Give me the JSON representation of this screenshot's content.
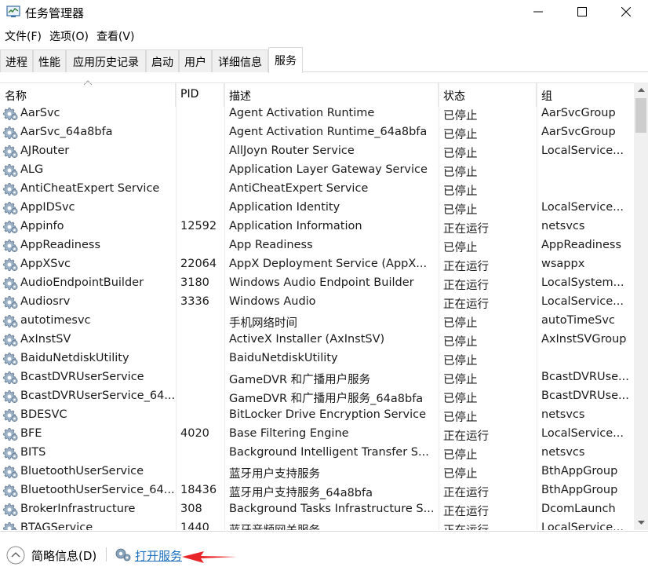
{
  "window": {
    "title": "任务管理器",
    "minimize_glyph": "—",
    "close_glyph": "✕"
  },
  "menu": [
    "文件(F)",
    "选项(O)",
    "查看(V)"
  ],
  "tabs": [
    "进程",
    "性能",
    "应用历史记录",
    "启动",
    "用户",
    "详细信息",
    "服务"
  ],
  "active_tab": "服务",
  "columns": {
    "name": "名称",
    "pid": "PID",
    "desc": "描述",
    "status": "状态",
    "group": "组"
  },
  "rows": [
    {
      "name": "AarSvc",
      "pid": "",
      "desc": "Agent Activation Runtime",
      "status": "已停止",
      "group": "AarSvcGroup"
    },
    {
      "name": "AarSvc_64a8bfa",
      "pid": "",
      "desc": "Agent Activation Runtime_64a8bfa",
      "status": "已停止",
      "group": "AarSvcGroup"
    },
    {
      "name": "AJRouter",
      "pid": "",
      "desc": "AllJoyn Router Service",
      "status": "已停止",
      "group": "LocalService..."
    },
    {
      "name": "ALG",
      "pid": "",
      "desc": "Application Layer Gateway Service",
      "status": "已停止",
      "group": ""
    },
    {
      "name": "AntiCheatExpert Service",
      "pid": "",
      "desc": "AntiCheatExpert Service",
      "status": "已停止",
      "group": ""
    },
    {
      "name": "AppIDSvc",
      "pid": "",
      "desc": "Application Identity",
      "status": "已停止",
      "group": "LocalService..."
    },
    {
      "name": "Appinfo",
      "pid": "12592",
      "desc": "Application Information",
      "status": "正在运行",
      "group": "netsvcs"
    },
    {
      "name": "AppReadiness",
      "pid": "",
      "desc": "App Readiness",
      "status": "已停止",
      "group": "AppReadiness"
    },
    {
      "name": "AppXSvc",
      "pid": "22064",
      "desc": "AppX Deployment Service (AppX...",
      "status": "正在运行",
      "group": "wsappx"
    },
    {
      "name": "AudioEndpointBuilder",
      "pid": "3180",
      "desc": "Windows Audio Endpoint Builder",
      "status": "正在运行",
      "group": "LocalSystem..."
    },
    {
      "name": "Audiosrv",
      "pid": "3336",
      "desc": "Windows Audio",
      "status": "正在运行",
      "group": "LocalService..."
    },
    {
      "name": "autotimesvc",
      "pid": "",
      "desc": "手机网络时间",
      "status": "已停止",
      "group": "autoTimeSvc"
    },
    {
      "name": "AxInstSV",
      "pid": "",
      "desc": "ActiveX Installer (AxInstSV)",
      "status": "已停止",
      "group": "AxInstSVGroup"
    },
    {
      "name": "BaiduNetdiskUtility",
      "pid": "",
      "desc": "BaiduNetdiskUtility",
      "status": "已停止",
      "group": ""
    },
    {
      "name": "BcastDVRUserService",
      "pid": "",
      "desc": "GameDVR 和广播用户服务",
      "status": "已停止",
      "group": "BcastDVRUse..."
    },
    {
      "name": "BcastDVRUserService_64...",
      "pid": "",
      "desc": "GameDVR 和广播用户服务_64a8bfa",
      "status": "已停止",
      "group": "BcastDVRUse..."
    },
    {
      "name": "BDESVC",
      "pid": "",
      "desc": "BitLocker Drive Encryption Service",
      "status": "已停止",
      "group": "netsvcs"
    },
    {
      "name": "BFE",
      "pid": "4020",
      "desc": "Base Filtering Engine",
      "status": "正在运行",
      "group": "LocalService..."
    },
    {
      "name": "BITS",
      "pid": "",
      "desc": "Background Intelligent Transfer S...",
      "status": "已停止",
      "group": "netsvcs"
    },
    {
      "name": "BluetoothUserService",
      "pid": "",
      "desc": "蓝牙用户支持服务",
      "status": "已停止",
      "group": "BthAppGroup"
    },
    {
      "name": "BluetoothUserService_64...",
      "pid": "18436",
      "desc": "蓝牙用户支持服务_64a8bfa",
      "status": "正在运行",
      "group": "BthAppGroup"
    },
    {
      "name": "BrokerInfrastructure",
      "pid": "308",
      "desc": "Background Tasks Infrastructure S...",
      "status": "正在运行",
      "group": "DcomLaunch"
    },
    {
      "name": "BTAGService",
      "pid": "1440",
      "desc": "蓝牙音频网关服务",
      "status": "正在运行",
      "group": "LocalService..."
    }
  ],
  "footer": {
    "brief": "简略信息(D)",
    "open_services": "打开服务"
  },
  "colors": {
    "link": "#1a6fbf",
    "arrow": "#e8262a"
  }
}
